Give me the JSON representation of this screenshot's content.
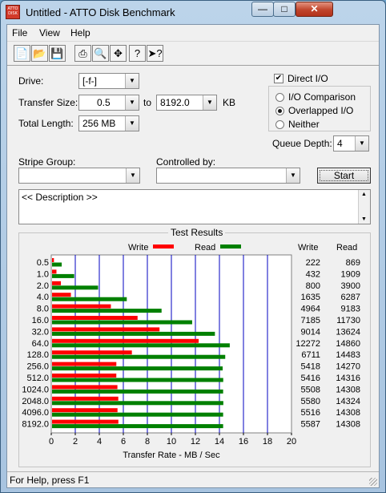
{
  "window": {
    "title": "Untitled - ATTO Disk Benchmark",
    "app_icon_text": "ATTO DISK"
  },
  "menu": [
    "File",
    "View",
    "Help"
  ],
  "toolbar_icons": [
    "new-file-icon",
    "open-folder-icon",
    "save-icon",
    "print-icon",
    "print-preview-icon",
    "move-icon",
    "help-icon",
    "context-help-icon"
  ],
  "settings": {
    "drive_label": "Drive:",
    "drive_value": "[-f-]",
    "transfer_size_label": "Transfer Size:",
    "transfer_from": "0.5",
    "transfer_to_label": "to",
    "transfer_to": "8192.0",
    "kb_label": "KB",
    "total_length_label": "Total Length:",
    "total_length_value": "256 MB",
    "direct_io_label": "Direct I/O",
    "direct_io_checked": true,
    "io_comparison_label": "I/O Comparison",
    "overlapped_io_label": "Overlapped I/O",
    "neither_label": "Neither",
    "selected_mode": "Overlapped I/O",
    "queue_depth_label": "Queue Depth:",
    "queue_depth_value": "4",
    "stripe_group_label": "Stripe Group:",
    "stripe_group_value": "",
    "controlled_by_label": "Controlled by:",
    "controlled_by_value": "",
    "start_label": "Start",
    "description_text": "<< Description >>"
  },
  "results": {
    "group_title": "Test Results",
    "legend_write": "Write",
    "legend_read": "Read",
    "col_write": "Write",
    "col_read": "Read"
  },
  "chart_data": {
    "type": "bar",
    "orientation": "horizontal",
    "categories": [
      "0.5",
      "1.0",
      "2.0",
      "4.0",
      "8.0",
      "16.0",
      "32.0",
      "64.0",
      "128.0",
      "256.0",
      "512.0",
      "1024.0",
      "2048.0",
      "4096.0",
      "8192.0"
    ],
    "series": [
      {
        "name": "Write",
        "color": "#ff0000",
        "values": [
          222,
          432,
          800,
          1635,
          4964,
          7185,
          9014,
          12272,
          6711,
          5418,
          5416,
          5508,
          5580,
          5516,
          5587
        ]
      },
      {
        "name": "Read",
        "color": "#008000",
        "values": [
          869,
          1909,
          3900,
          6287,
          9183,
          11730,
          13624,
          14860,
          14483,
          14270,
          14316,
          14308,
          14324,
          14308,
          14308
        ]
      }
    ],
    "xlabel": "Transfer Rate - MB / Sec",
    "xlim": [
      0,
      20
    ],
    "xticks": [
      "0",
      "2",
      "4",
      "6",
      "8",
      "10",
      "12",
      "14",
      "16",
      "18",
      "20"
    ],
    "legend": "top",
    "grid": true
  },
  "status": {
    "text": "For Help, press F1"
  }
}
